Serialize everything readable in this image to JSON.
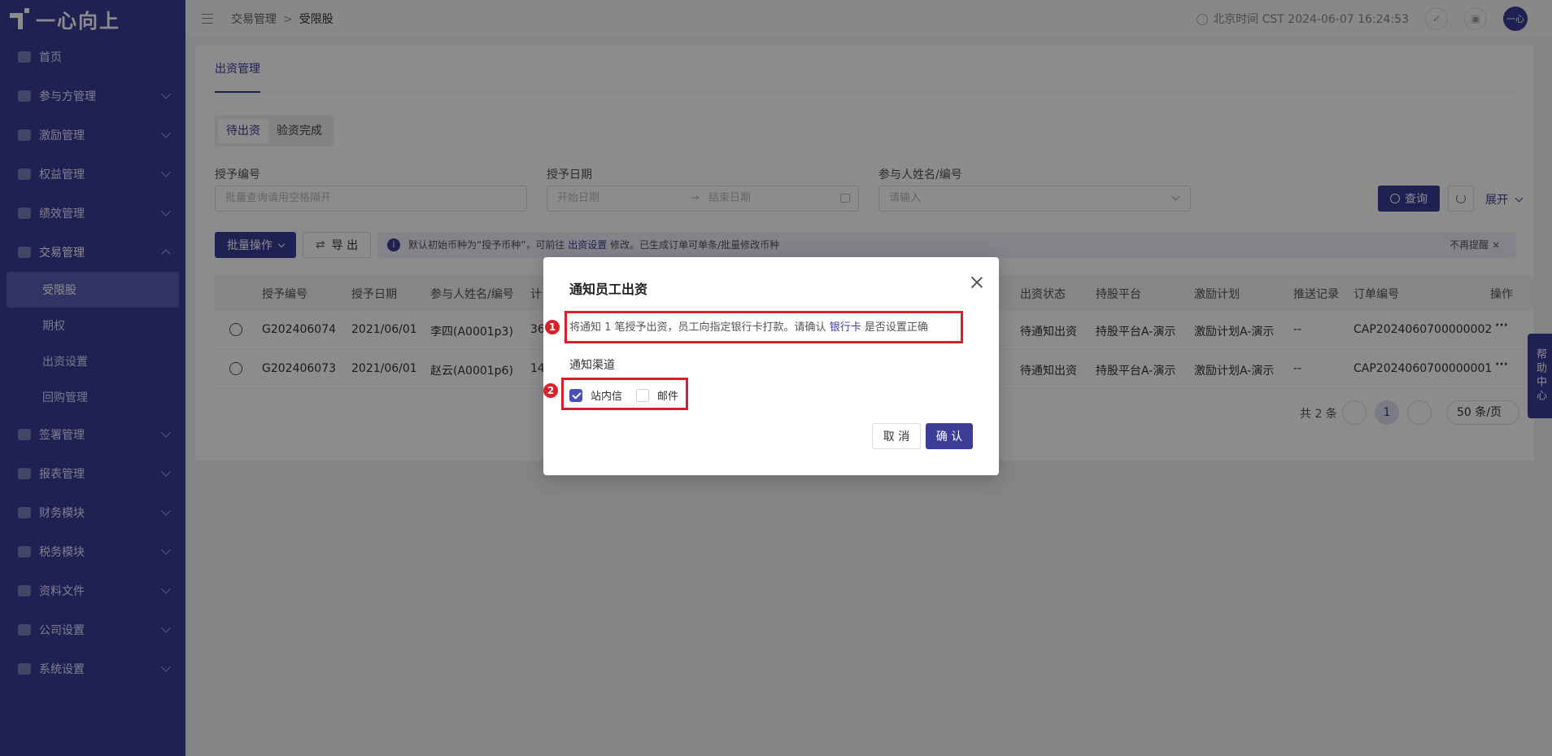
{
  "logo": "一心向上",
  "sidebar": {
    "items": [
      {
        "label": "首页"
      },
      {
        "label": "参与方管理"
      },
      {
        "label": "激励管理"
      },
      {
        "label": "权益管理"
      },
      {
        "label": "绩效管理"
      },
      {
        "label": "交易管理"
      },
      {
        "label": "签署管理"
      },
      {
        "label": "报表管理"
      },
      {
        "label": "财务模块"
      },
      {
        "label": "税务模块"
      },
      {
        "label": "资料文件"
      },
      {
        "label": "公司设置"
      },
      {
        "label": "系统设置"
      }
    ],
    "sub_items": [
      {
        "label": "受限股"
      },
      {
        "label": "期权"
      },
      {
        "label": "出资设置"
      },
      {
        "label": "回购管理"
      }
    ]
  },
  "breadcrumb": {
    "parent": "交易管理",
    "separator": ">",
    "current": "受限股"
  },
  "topbar": {
    "time": "北京时间 CST 2024-06-07 16:24:53",
    "avatar": "一心"
  },
  "main": {
    "tab": "出资管理",
    "segments": [
      "待出资",
      "验资完成"
    ],
    "filters": {
      "grant_no_label": "授予编号",
      "grant_no_placeholder": "批量查询请用空格隔开",
      "grant_date_label": "授予日期",
      "start_placeholder": "开始日期",
      "end_placeholder": "结束日期",
      "participant_label": "参与人姓名/编号",
      "participant_placeholder": "请输入"
    },
    "query": "查询",
    "expand": "展开",
    "bulk": "批量操作",
    "export": "导 出",
    "notice": {
      "prefix": "默认初始币种为“授予币种”，可前往",
      "link": "出资设置",
      "suffix": "修改。已生成订单可单条/批量修改币种",
      "dismiss": "不再提醒"
    },
    "table": {
      "columns": [
        "授予编号",
        "授予日期",
        "参与人姓名/编号",
        "计",
        "出资状态",
        "持股平台",
        "激励计划",
        "推送记录",
        "订单编号",
        "操作"
      ],
      "rows": [
        {
          "grant_no": "G202406074",
          "date": "2021/06/01",
          "participant": "李四(A0001p3)",
          "plan_qty": "36",
          "status": "待通知出资",
          "platform": "持股平台A-演示",
          "plan": "激励计划A-演示",
          "push": "--",
          "order": "CAP2024060700000002",
          "op": "···"
        },
        {
          "grant_no": "G202406073",
          "date": "2021/06/01",
          "participant": "赵云(A0001p6)",
          "plan_qty": "14",
          "status": "待通知出资",
          "platform": "持股平台A-演示",
          "plan": "激励计划A-演示",
          "push": "--",
          "order": "CAP2024060700000001",
          "op": "···"
        }
      ]
    },
    "pagination": {
      "total": "共 2 条",
      "page": "1",
      "size": "50 条/页"
    }
  },
  "help": "帮助中心",
  "modal": {
    "title": "通知员工出资",
    "msg_prefix": "将通知 1 笔授予出资，员工向指定银行卡打款。请确认",
    "msg_link": "银行卡",
    "msg_suffix": "是否设置正确",
    "channel_label": "通知渠道",
    "channels": [
      {
        "label": "站内信",
        "checked": true
      },
      {
        "label": "邮件",
        "checked": false
      }
    ],
    "cancel": "取 消",
    "confirm": "确 认"
  },
  "annotations": [
    "1",
    "2"
  ],
  "colors": {
    "primary": "#3b3d97",
    "highlight": "#d9212c",
    "sidebar_active": "#5a5db5"
  }
}
